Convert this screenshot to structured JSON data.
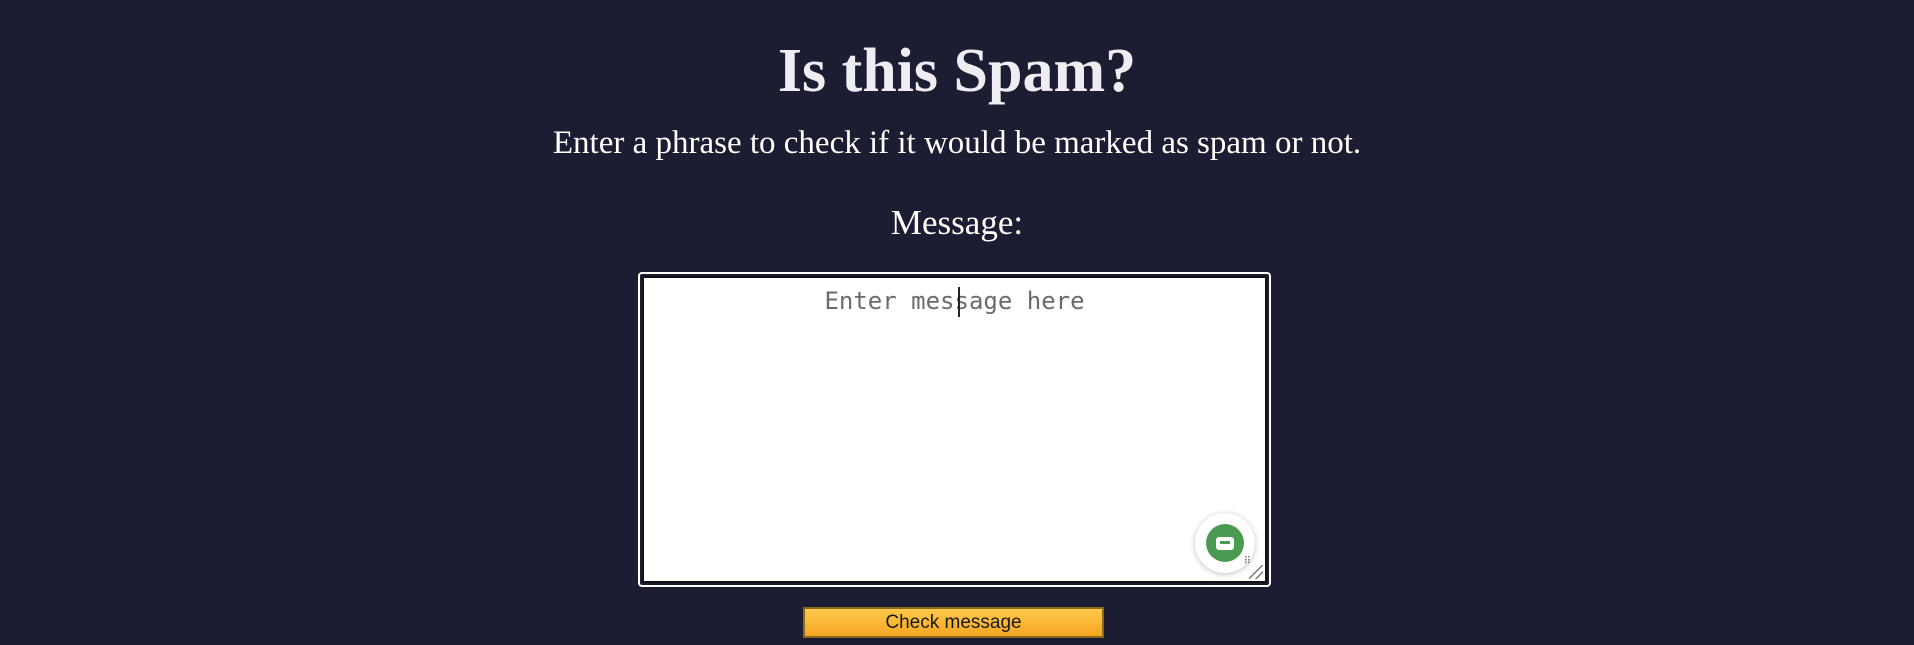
{
  "page": {
    "title": "Is this Spam?",
    "subtitle": "Enter a phrase to check if it would be marked as spam or not.",
    "message_label": "Message:"
  },
  "form": {
    "message_placeholder": "Enter message here",
    "message_value": "",
    "submit_label": "Check message"
  },
  "icons": {
    "grammar_badge": "grammar-assistant-icon",
    "resize": "resize-handle-icon"
  },
  "colors": {
    "background": "#1c1c33",
    "button": "#f5a623",
    "badge": "#4a9a52"
  }
}
